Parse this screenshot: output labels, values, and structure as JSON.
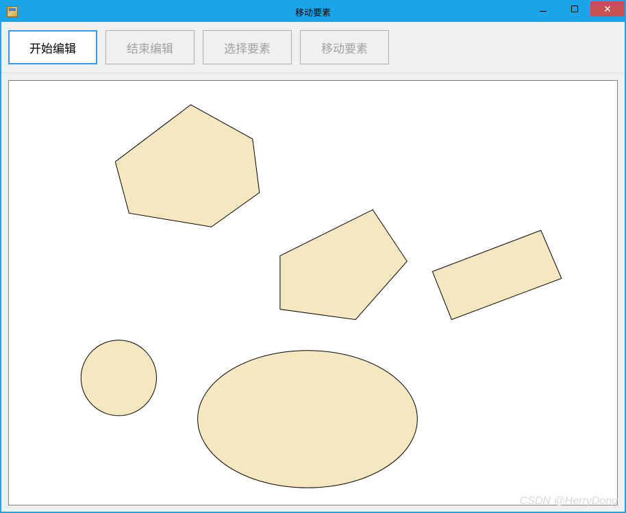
{
  "window": {
    "title": "移动要素"
  },
  "toolbar": {
    "buttons": [
      {
        "label": "开始编辑",
        "state": "active"
      },
      {
        "label": "结束编辑",
        "state": "disabled"
      },
      {
        "label": "选择要素",
        "state": "disabled"
      },
      {
        "label": "移动要素",
        "state": "disabled"
      }
    ]
  },
  "shapes": {
    "fill_color": "#f5e7bf",
    "stroke_color": "#000000"
  },
  "watermark": "CSDN @HerryDong"
}
